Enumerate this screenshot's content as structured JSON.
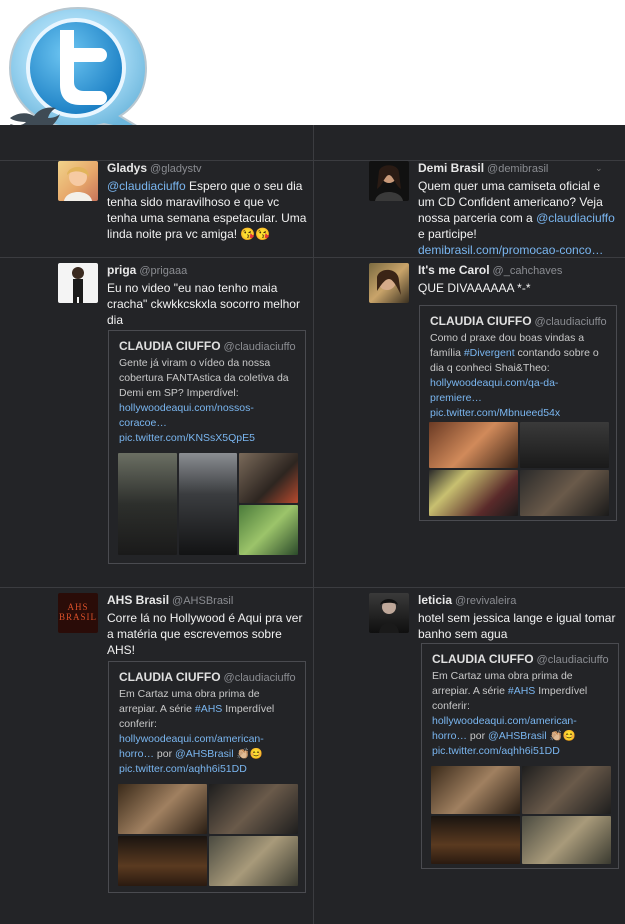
{
  "tweets": [
    {
      "name": "Gladys",
      "handle": "@gladystv",
      "text_pre": "",
      "mention": "@claudiaciuffo",
      "text_post": " Espero que o seu dia tenha sido maravilhoso e que vc tenha uma semana espetacular. Uma linda noite pra vc amiga! 😘😘"
    },
    {
      "name": "Demi Brasil",
      "handle": "@demibrasil",
      "text_pre": "Quem quer uma camiseta oficial e um CD Confident americano? Veja nossa parceria com a ",
      "mention": "@claudiaciuffo",
      "text_post": " e participe!",
      "link": "demibrasil.com/promocao-conco…"
    },
    {
      "name": "priga",
      "handle": "@prigaaa",
      "text": "Eu no video \"eu nao tenho maia cracha\" ckwkkcskxla socorro melhor dia"
    },
    {
      "name": "It's me Carol",
      "handle": "@_cahchaves",
      "text": "QUE DIVAAAAAA *-*"
    },
    {
      "name": "AHS Brasil",
      "handle": "@AHSBrasil",
      "text": "Corre lá no Hollywood é Aqui pra ver a matéria que escrevemos sobre AHS!",
      "avatar_text": "AHS BRASIL"
    },
    {
      "name": "leticia",
      "handle": "@revivaleira",
      "text": "hotel sem jessica lange e igual tomar banho sem agua"
    }
  ],
  "cards": [
    {
      "name": "CLAUDIA CIUFFO",
      "handle": "@claudiaciuffo",
      "text": "Gente já viram o vídeo da nossa cobertura FANTAstica da coletiva da Demi em SP? Imperdível:",
      "link1": "hollywoodeaqui.com/nossos-coracoe…",
      "link2": "pic.twitter.com/KNSsX5QpE5"
    },
    {
      "name": "CLAUDIA CIUFFO",
      "handle": "@claudiaciuffo",
      "text_pre": "Como d praxe dou boas vindas a família ",
      "hashtag": "#Divergent",
      "text_post": " contando sobre o dia q conheci Shai&Theo:",
      "link1": "hollywoodeaqui.com/qa-da-premiere…",
      "link2": "pic.twitter.com/Mbnueed54x"
    },
    {
      "name": "CLAUDIA CIUFFO",
      "handle": "@claudiaciuffo",
      "text_pre": "Em Cartaz uma obra prima de arrepiar. A série ",
      "hashtag": "#AHS",
      "text_post": " Imperdível conferir:",
      "link1": "hollywoodeaqui.com/american-horro…",
      "por": " por ",
      "mention": "@AHSBrasil",
      "emoji": " 👏🏼😊",
      "link2": "pic.twitter.com/aqhh6i51DD"
    },
    {
      "name": "CLAUDIA CIUFFO",
      "handle": "@claudiaciuffo",
      "text_pre": "Em Cartaz uma obra prima de arrepiar. A série ",
      "hashtag": "#AHS",
      "text_post": " Imperdível conferir:",
      "link1": "hollywoodeaqui.com/american-horro…",
      "por": " por ",
      "mention": "@AHSBrasil",
      "emoji": " 👏🏼😊",
      "link2": "pic.twitter.com/aqhh6i51DD"
    }
  ],
  "colors": {
    "background": "#232427",
    "link": "#7ab6f0",
    "twitter_blue": "#3d9bd9"
  },
  "icons": {
    "logo": "twitter-bird-logo",
    "caret": "caret-down-icon"
  }
}
